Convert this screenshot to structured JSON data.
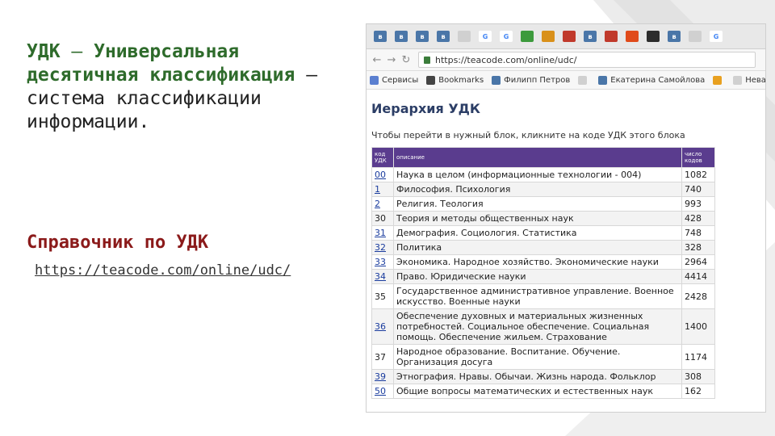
{
  "slide": {
    "title_term": "УДК",
    "title_dash": " – ",
    "title_highlight": "Универсальная десятичная классификация",
    "title_dash2": " – ",
    "title_rest": "система классификации информации.",
    "ref_label": "Справочник по УДК",
    "ref_url": "https://teacode.com/online/udc/"
  },
  "browser": {
    "tabs": [
      {
        "icon": "vk-icon",
        "glyph": "в",
        "color": "#4a76a8"
      },
      {
        "icon": "vk-icon",
        "glyph": "в",
        "color": "#4a76a8"
      },
      {
        "icon": "vk-icon",
        "glyph": "в",
        "color": "#4a76a8"
      },
      {
        "icon": "vk-icon",
        "glyph": "в",
        "color": "#4a76a8"
      },
      {
        "icon": "page-icon",
        "glyph": "",
        "color": "#d0d0d0"
      },
      {
        "icon": "google-icon",
        "glyph": "G",
        "color": "#ffffff"
      },
      {
        "icon": "google-icon",
        "glyph": "G",
        "color": "#ffffff"
      },
      {
        "icon": "green-icon",
        "glyph": "",
        "color": "#3c9a3c"
      },
      {
        "icon": "orange-icon",
        "glyph": "",
        "color": "#d9901a"
      },
      {
        "icon": "red-icon",
        "glyph": "",
        "color": "#c0392b"
      },
      {
        "icon": "vk-icon",
        "glyph": "в",
        "color": "#4a76a8"
      },
      {
        "icon": "red-icon",
        "glyph": "",
        "color": "#c0392b"
      },
      {
        "icon": "pacman-icon",
        "glyph": "",
        "color": "#e04a1a"
      },
      {
        "icon": "dark-icon",
        "glyph": "",
        "color": "#2c2c2c"
      },
      {
        "icon": "vk-icon",
        "glyph": "в",
        "color": "#4a76a8"
      },
      {
        "icon": "page-icon",
        "glyph": "",
        "color": "#d0d0d0"
      },
      {
        "icon": "google-icon",
        "glyph": "G",
        "color": "#ffffff"
      }
    ],
    "url": "https://teacode.com/online/udc/",
    "bookmarks": [
      {
        "label": "Сервисы",
        "icon": "apps-icon",
        "color": "#5a7fd0"
      },
      {
        "label": "Bookmarks",
        "icon": "star-icon",
        "color": "#444444"
      },
      {
        "label": "Филипп Петров",
        "icon": "vk-icon",
        "color": "#4a76a8"
      },
      {
        "label": "",
        "icon": "page-icon",
        "color": "#d0d0d0"
      },
      {
        "label": "Екатерина Самойлова",
        "icon": "vk-icon",
        "color": "#4a76a8"
      },
      {
        "label": "",
        "icon": "orange-icon",
        "color": "#e8a020"
      },
      {
        "label": "Нева Г",
        "icon": "page-icon",
        "color": "#d0d0d0"
      }
    ]
  },
  "page": {
    "title": "Иерархия УДК",
    "hint": "Чтобы перейти в нужный блок, кликните на коде УДК этого блока",
    "headers": {
      "code": "код УДК",
      "desc": "описание",
      "count": "число кодов"
    },
    "rows": [
      {
        "code": "00",
        "desc": "Наука в целом (информационные технологии - 004)",
        "count": "1082"
      },
      {
        "code": "1",
        "desc": "Философия. Психология",
        "count": "740"
      },
      {
        "code": "2",
        "desc": "Религия. Теология",
        "count": "993"
      },
      {
        "code": "30",
        "desc": "Теория и методы общественных наук",
        "count": "428"
      },
      {
        "code": "31",
        "desc": "Демография. Социология. Статистика",
        "count": "748"
      },
      {
        "code": "32",
        "desc": "Политика",
        "count": "328"
      },
      {
        "code": "33",
        "desc": "Экономика. Народное хозяйство. Экономические науки",
        "count": "2964"
      },
      {
        "code": "34",
        "desc": "Право. Юридические науки",
        "count": "4414"
      },
      {
        "code": "35",
        "desc": "Государственное административное управление. Военное искусство. Военные науки",
        "count": "2428"
      },
      {
        "code": "36",
        "desc": "Обеспечение духовных и материальных жизненных потребностей. Социальное обеспечение. Социальная помощь. Обеспечение жильем. Страхование",
        "count": "1400"
      },
      {
        "code": "37",
        "desc": "Народное образование. Воспитание. Обучение. Организация досуга",
        "count": "1174"
      },
      {
        "code": "39",
        "desc": "Этнография. Нравы. Обычаи. Жизнь народа. Фольклор",
        "count": "308"
      },
      {
        "code": "50",
        "desc": "Общие вопросы математических и естественных наук",
        "count": "162"
      }
    ]
  },
  "colors": {
    "title_green": "#2e6b2b",
    "ref_red": "#8b1a1a",
    "table_header": "#5a3c8e"
  }
}
